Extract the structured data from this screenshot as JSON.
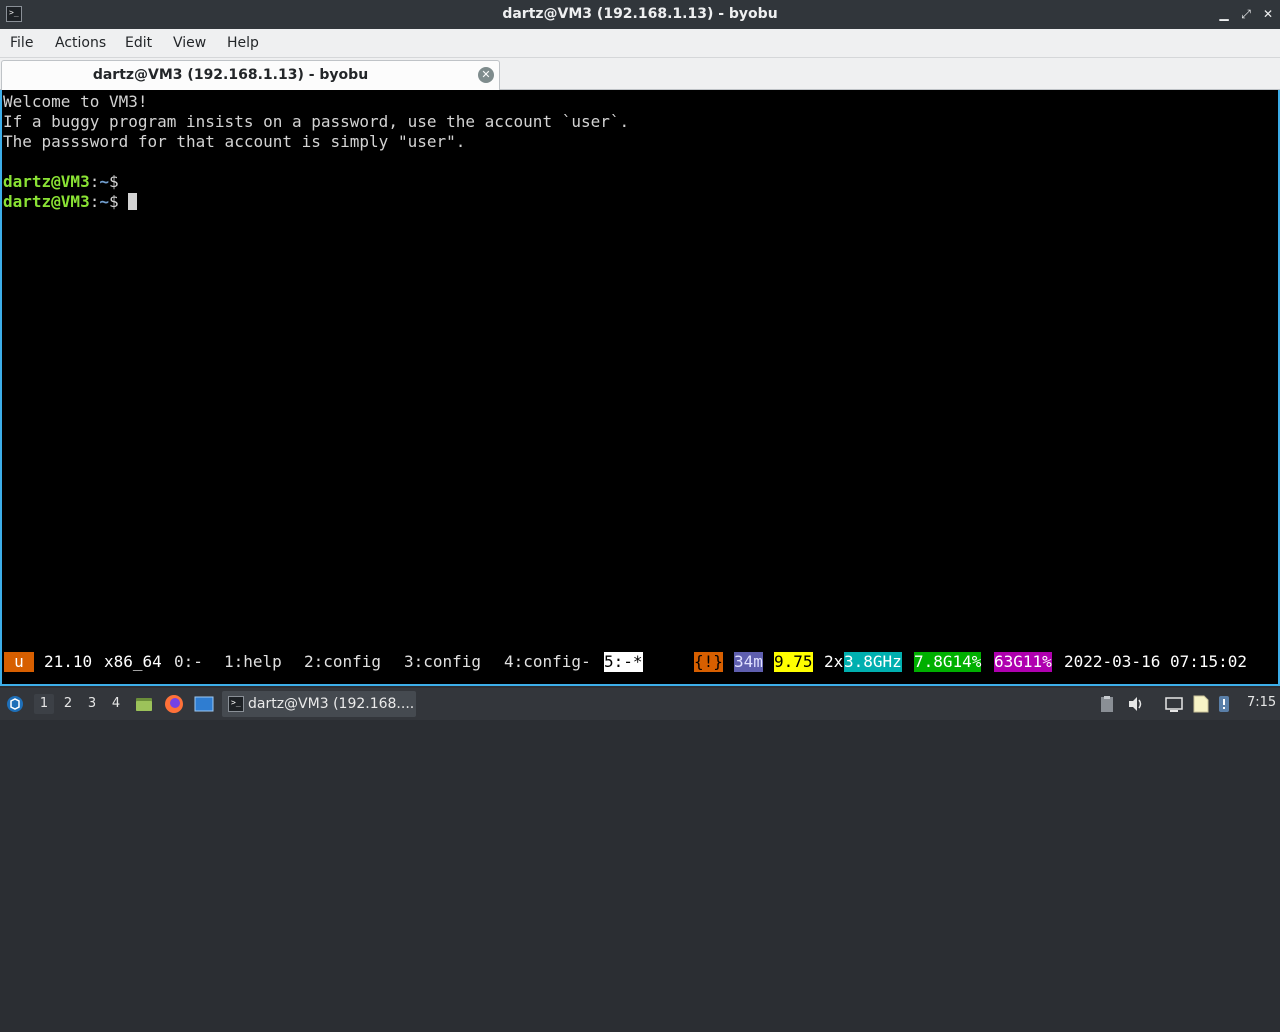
{
  "window": {
    "title": "dartz@VM3 (192.168.1.13) - byobu",
    "controls": {
      "minimize": "▁",
      "maximize": "⤢",
      "close": "✕"
    }
  },
  "menu": [
    "File",
    "Actions",
    "Edit",
    "View",
    "Help"
  ],
  "tab": {
    "label": "dartz@VM3 (192.168.1.13) - byobu",
    "close_icon": "✕"
  },
  "terminal": {
    "lines": [
      "Welcome to VM3!",
      "If a buggy program insists on a password, use the account `user`.",
      "The passsword for that account is simply \"user\"."
    ],
    "prompt_user": "dartz@VM3",
    "prompt_sep": ":",
    "prompt_path": "~",
    "prompt_sym": "$"
  },
  "byobu": {
    "indicator": "u",
    "release": "21.10",
    "arch": "x86_64",
    "windows": [
      "0:-",
      "1:help",
      "2:config",
      "3:config",
      "4:config-",
      "5:-*"
    ],
    "alert": "{!}",
    "uptime": "34m",
    "load": "9.75",
    "cpu_count": "2x",
    "cpu_freq": "3.8GHz",
    "mem": "7.8G14%",
    "disk": "63G11%",
    "datetime": "2022-03-16 07:15:02"
  },
  "taskbar": {
    "workspaces": [
      "1",
      "2",
      "3",
      "4"
    ],
    "active_task": "dartz@VM3 (192.168....",
    "clock": "7:15"
  },
  "colors": {
    "accent": "#3daee9",
    "prompt_user": "#8ae234",
    "prompt_path": "#729fcf",
    "byobu_orange": "#d75f00",
    "byobu_blue": "#5f5faf",
    "byobu_yellow": "#ffff00",
    "byobu_cyan": "#00afaf",
    "byobu_green": "#00af00",
    "byobu_magenta": "#af00af"
  }
}
